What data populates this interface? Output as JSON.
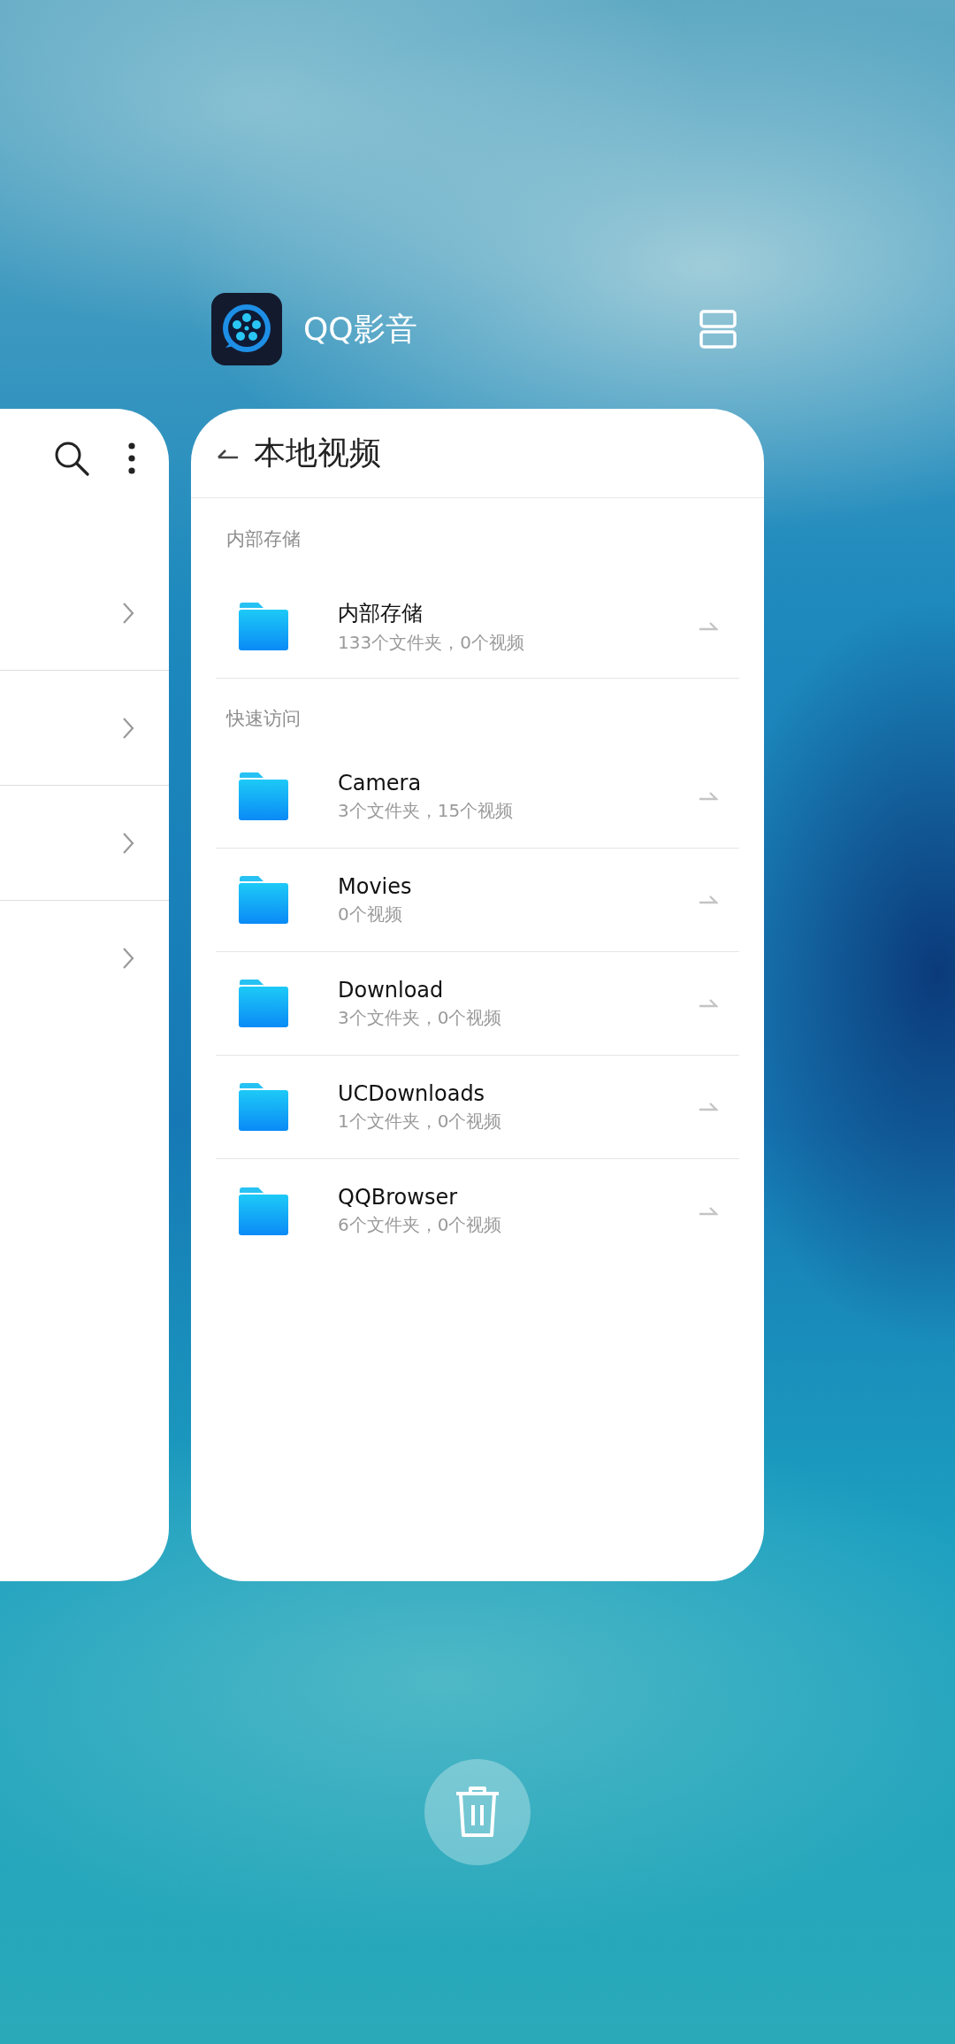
{
  "app": {
    "title": "QQ影音"
  },
  "screen": {
    "title": "本地视频"
  },
  "sections": [
    {
      "label": "内部存储",
      "folders": [
        {
          "name": "内部存储",
          "detail": "133个文件夹，0个视频"
        }
      ]
    },
    {
      "label": "快速访问",
      "folders": [
        {
          "name": "Camera",
          "detail": "3个文件夹，15个视频"
        },
        {
          "name": "Movies",
          "detail": "0个视频"
        },
        {
          "name": "Download",
          "detail": "3个文件夹，0个视频"
        },
        {
          "name": "UCDownloads",
          "detail": "1个文件夹，0个视频"
        },
        {
          "name": "QQBrowser",
          "detail": "6个文件夹，0个视频"
        }
      ]
    }
  ]
}
